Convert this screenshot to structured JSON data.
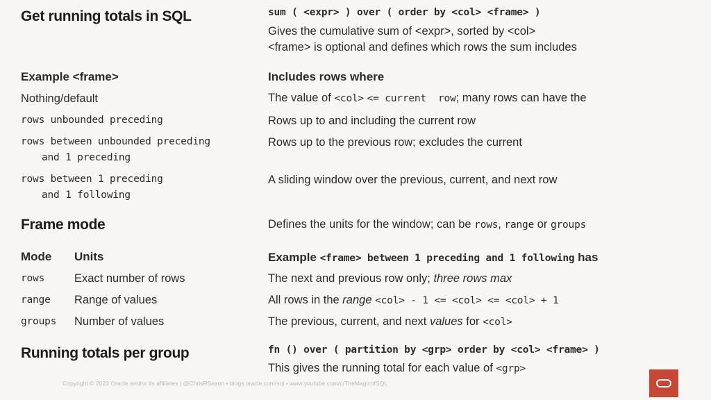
{
  "slide": {
    "background_color": "#f7f6f4",
    "text_color": "#2b2b2b",
    "accent_color": "#c74634"
  },
  "header": {
    "title": "Get running totals in SQL",
    "signature": "sum ( <expr> ) over ( order by <col> <frame> )",
    "description_line_1": "Gives the cumulative sum of <expr>, sorted by <col>",
    "description_line_2": "<frame> is optional and defines which rows the sum includes"
  },
  "frame_table": {
    "left_header": "Example <frame>",
    "right_header": "Includes rows where",
    "rows": [
      {
        "frame_line_1": "Nothing/default",
        "frame_line_2": "",
        "describes": "The value of <col> <= current  row; many rows can have the"
      },
      {
        "frame_line_1": "rows unbounded preceding",
        "frame_line_2": "",
        "describes": "Rows up to and including the current row"
      },
      {
        "frame_line_1": "rows between unbounded preceding",
        "frame_line_2": "and 1 preceding",
        "describes": "Rows up to the previous row; excludes the current"
      },
      {
        "frame_line_1": "rows between 1 preceding",
        "frame_line_2": "and 1 following",
        "describes": "A sliding window over the previous, current, and next row"
      }
    ]
  },
  "frame_mode": {
    "title": "Frame mode",
    "description": "Defines the units for the window; can be rows, range or groups",
    "description_parts": {
      "lead": "Defines the units for the window; can be ",
      "code_1": "rows",
      "sep_1": ", ",
      "code_2": "range",
      "sep_2": " or ",
      "code_3": "groups"
    },
    "columns": {
      "mode": "Mode",
      "units": "Units"
    },
    "example_header": {
      "label": "Example ",
      "code": "<frame> between 1 preceding and 1 following",
      "tail": " has"
    },
    "rows": [
      {
        "mode": "rows",
        "units": "Exact number of rows",
        "example_parts": {
          "lead": "The next and previous row only; ",
          "italic": "three rows max",
          "tail": ""
        }
      },
      {
        "mode": "range",
        "units": "Range of values",
        "example_parts": {
          "lead": "All rows in the ",
          "italic": "range",
          "code": "<col> - 1 <= <col> <= <col> + 1",
          "tail": ""
        }
      },
      {
        "mode": "groups",
        "units": "Number of values",
        "example_parts": {
          "lead": "The previous, current, and next ",
          "italic": "values",
          "mid": " for ",
          "code": "<col>",
          "tail": ""
        }
      }
    ]
  },
  "group_section": {
    "title": "Running totals per group",
    "signature": "fn () over ( partition by <grp> order by <col> <frame> )",
    "description_lead": "This gives the running total for each value of ",
    "description_code": "<grp>"
  },
  "footer": {
    "text": "Copyright © 2023 Oracle and/or its affiliates | @ChrisRSaxon • blogs.oracle.com/sql • www.youtube.com/c/TheMagicofSQL"
  },
  "logo": {
    "name": "oracle-logo",
    "color": "#c74634"
  }
}
